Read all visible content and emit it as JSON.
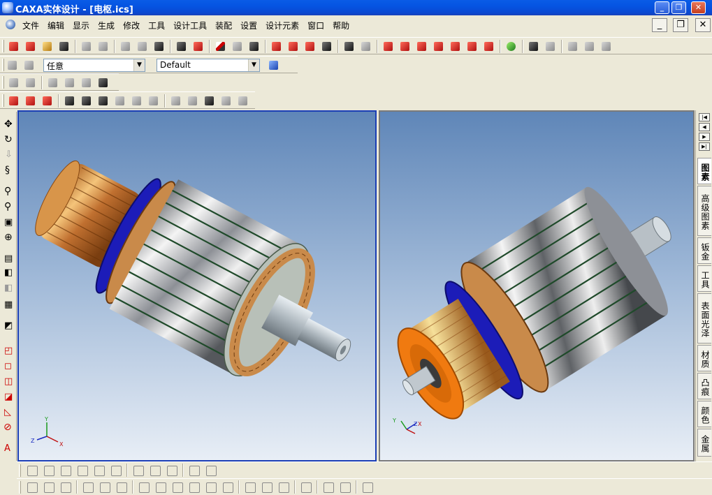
{
  "window": {
    "title": "CAXA实体设计 - [电枢.ics]"
  },
  "menu": {
    "items": [
      "文件",
      "编辑",
      "显示",
      "生成",
      "修改",
      "工具",
      "设计工具",
      "装配",
      "设置",
      "设计元素",
      "窗口",
      "帮助"
    ]
  },
  "toolbar": {
    "selection_filter": "任意",
    "style_filter": "Default"
  },
  "right_panel": {
    "tabs": [
      "图素",
      "高级图素",
      "钣金",
      "工具",
      "表面光泽",
      "材质",
      "凸痕",
      "颜色",
      "金属"
    ],
    "active_tab": "图素"
  },
  "viewports": {
    "left": {
      "axis_labels": [
        "Y",
        "Z",
        "X"
      ]
    },
    "right": {
      "axis_labels": [
        "Y",
        "Z",
        "X"
      ]
    }
  },
  "colors": {
    "titlebar": "#0a54e2",
    "viewport_top": "#5f86b8",
    "viewport_bottom": "#e8eef6",
    "copper": "#d08a3a",
    "blue_ring": "#1c1cb8",
    "orange_cap": "#f07a10"
  }
}
